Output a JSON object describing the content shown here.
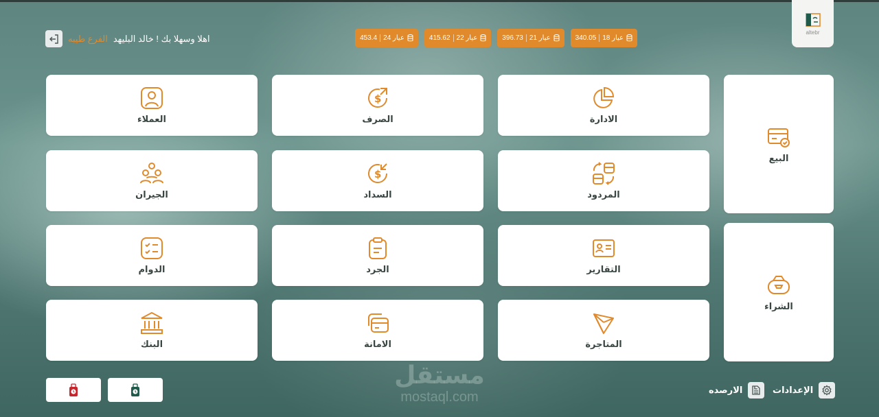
{
  "header": {
    "logo_text": "altebr",
    "prices": [
      {
        "label": "عيار 18",
        "value": "340.05"
      },
      {
        "label": "عيار 21",
        "value": "396.73"
      },
      {
        "label": "عيار 22",
        "value": "415.62"
      },
      {
        "label": "عيار 24",
        "value": "453.4"
      }
    ],
    "branch": "الفرع طيبه",
    "welcome": "اهلا وسهلا بك ! خالد البليهد"
  },
  "tiles": {
    "sale": "البيع",
    "purchase": "الشراء",
    "management": "الادارة",
    "returns": "المردود",
    "reports": "التقارير",
    "trading": "المتاجرة",
    "exchange": "الصرف",
    "payment": "السداد",
    "inventory": "الجرد",
    "deposit": "الامانة",
    "customers": "العملاء",
    "neighbors": "الجيران",
    "attendance": "الدوام",
    "bank": "البنك"
  },
  "bottom": {
    "settings": "الإعدادات",
    "balances": "الارصده"
  },
  "watermark": {
    "arabic": "مستقل",
    "latin": "mostaql.com"
  },
  "colors": {
    "accent": "#e08a2c",
    "tile_bg": "#ffffff",
    "label_text": "#3a4643"
  }
}
